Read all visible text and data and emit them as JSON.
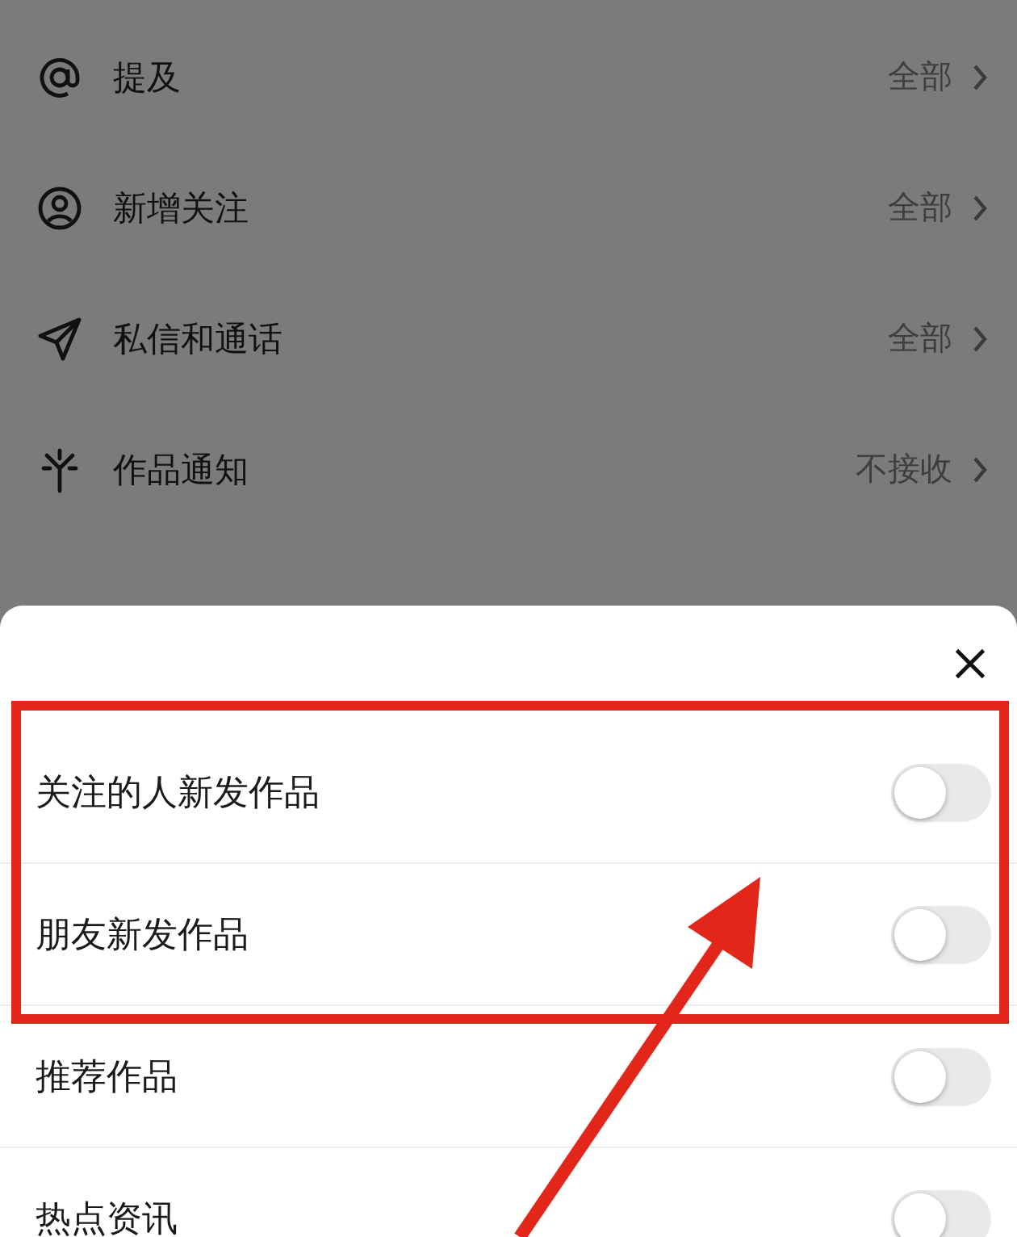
{
  "background_list": [
    {
      "kind": "at",
      "label": "提及",
      "value": "全部"
    },
    {
      "kind": "person",
      "label": "新增关注",
      "value": "全部"
    },
    {
      "kind": "send",
      "label": "私信和通话",
      "value": "全部"
    },
    {
      "kind": "sparkle",
      "label": "作品通知",
      "value": "不接收"
    }
  ],
  "sheet": {
    "options": [
      {
        "label": "关注的人新发作品",
        "on": false
      },
      {
        "label": "朋友新发作品",
        "on": false
      },
      {
        "label": "推荐作品",
        "on": false
      },
      {
        "label": "热点资讯",
        "on": false
      }
    ]
  }
}
